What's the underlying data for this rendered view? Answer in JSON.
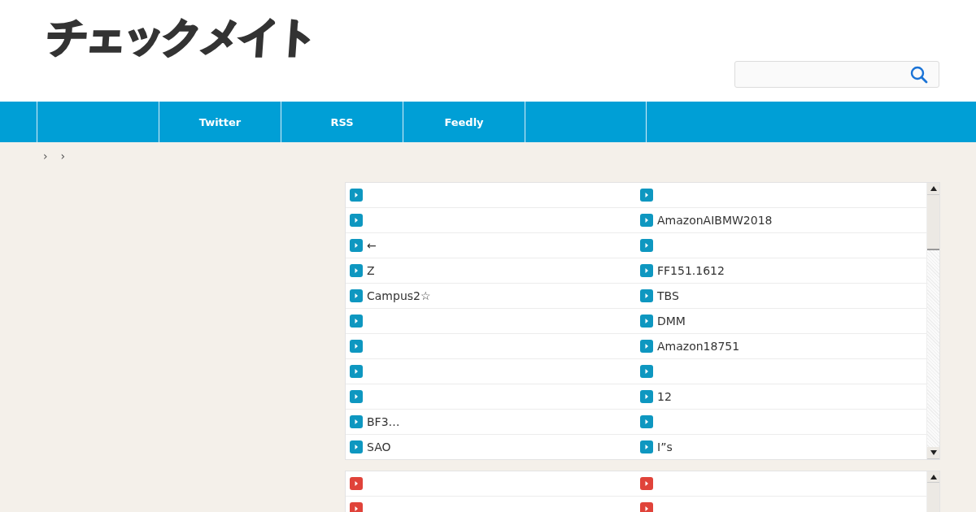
{
  "header": {
    "logo": "チェックメイト"
  },
  "nav": {
    "items": [
      {
        "label": "Twitter"
      },
      {
        "label": "RSS"
      },
      {
        "label": "Feedly"
      }
    ]
  },
  "breadcrumb": {
    "separators": [
      "›",
      "›"
    ]
  },
  "panels": [
    {
      "color": "#0e97c0",
      "rows": [
        {
          "left": {},
          "right": {}
        },
        {
          "left": {},
          "right": {
            "text": "AmazonAIBMW2018"
          }
        },
        {
          "left": {
            "text": "←"
          },
          "right": {}
        },
        {
          "left": {
            "text": "Z"
          },
          "right": {
            "text": "FF151.1612"
          }
        },
        {
          "left": {
            "text": "Campus2☆"
          },
          "right": {
            "text": "TBS"
          }
        },
        {
          "left": {},
          "right": {
            "text": "DMM"
          }
        },
        {
          "left": {},
          "right": {
            "text": "Amazon18751"
          }
        },
        {
          "left": {},
          "right": {}
        },
        {
          "left": {},
          "right": {
            "text": "12"
          }
        },
        {
          "left": {
            "text": "BF3…"
          },
          "right": {}
        },
        {
          "left": {
            "text": "SAO"
          },
          "right": {
            "text": "I”s"
          }
        }
      ]
    },
    {
      "color": "#e0433a",
      "rows": [
        {
          "left": {},
          "right": {}
        },
        {
          "left": {},
          "right": {}
        }
      ]
    }
  ]
}
